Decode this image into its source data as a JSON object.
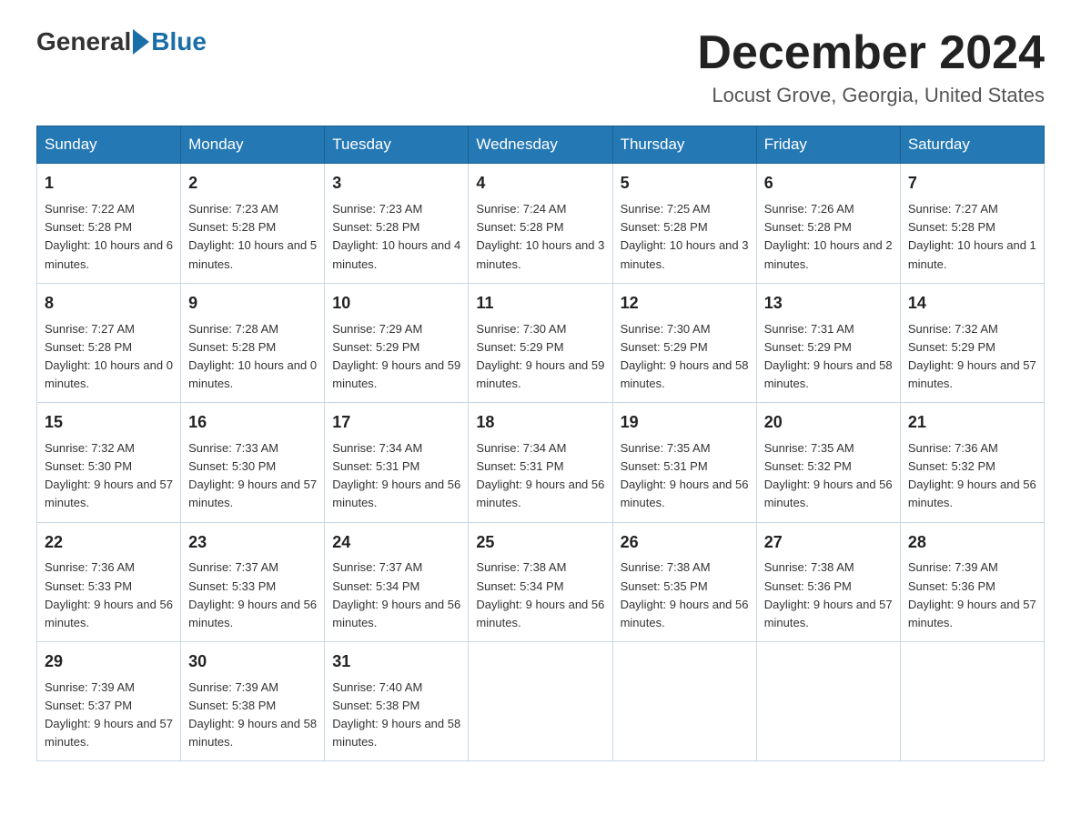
{
  "header": {
    "logo_general": "General",
    "logo_blue": "Blue",
    "month_title": "December 2024",
    "location": "Locust Grove, Georgia, United States"
  },
  "weekdays": [
    "Sunday",
    "Monday",
    "Tuesday",
    "Wednesday",
    "Thursday",
    "Friday",
    "Saturday"
  ],
  "weeks": [
    [
      {
        "day": "1",
        "sunrise": "7:22 AM",
        "sunset": "5:28 PM",
        "daylight": "10 hours and 6 minutes."
      },
      {
        "day": "2",
        "sunrise": "7:23 AM",
        "sunset": "5:28 PM",
        "daylight": "10 hours and 5 minutes."
      },
      {
        "day": "3",
        "sunrise": "7:23 AM",
        "sunset": "5:28 PM",
        "daylight": "10 hours and 4 minutes."
      },
      {
        "day": "4",
        "sunrise": "7:24 AM",
        "sunset": "5:28 PM",
        "daylight": "10 hours and 3 minutes."
      },
      {
        "day": "5",
        "sunrise": "7:25 AM",
        "sunset": "5:28 PM",
        "daylight": "10 hours and 3 minutes."
      },
      {
        "day": "6",
        "sunrise": "7:26 AM",
        "sunset": "5:28 PM",
        "daylight": "10 hours and 2 minutes."
      },
      {
        "day": "7",
        "sunrise": "7:27 AM",
        "sunset": "5:28 PM",
        "daylight": "10 hours and 1 minute."
      }
    ],
    [
      {
        "day": "8",
        "sunrise": "7:27 AM",
        "sunset": "5:28 PM",
        "daylight": "10 hours and 0 minutes."
      },
      {
        "day": "9",
        "sunrise": "7:28 AM",
        "sunset": "5:28 PM",
        "daylight": "10 hours and 0 minutes."
      },
      {
        "day": "10",
        "sunrise": "7:29 AM",
        "sunset": "5:29 PM",
        "daylight": "9 hours and 59 minutes."
      },
      {
        "day": "11",
        "sunrise": "7:30 AM",
        "sunset": "5:29 PM",
        "daylight": "9 hours and 59 minutes."
      },
      {
        "day": "12",
        "sunrise": "7:30 AM",
        "sunset": "5:29 PM",
        "daylight": "9 hours and 58 minutes."
      },
      {
        "day": "13",
        "sunrise": "7:31 AM",
        "sunset": "5:29 PM",
        "daylight": "9 hours and 58 minutes."
      },
      {
        "day": "14",
        "sunrise": "7:32 AM",
        "sunset": "5:29 PM",
        "daylight": "9 hours and 57 minutes."
      }
    ],
    [
      {
        "day": "15",
        "sunrise": "7:32 AM",
        "sunset": "5:30 PM",
        "daylight": "9 hours and 57 minutes."
      },
      {
        "day": "16",
        "sunrise": "7:33 AM",
        "sunset": "5:30 PM",
        "daylight": "9 hours and 57 minutes."
      },
      {
        "day": "17",
        "sunrise": "7:34 AM",
        "sunset": "5:31 PM",
        "daylight": "9 hours and 56 minutes."
      },
      {
        "day": "18",
        "sunrise": "7:34 AM",
        "sunset": "5:31 PM",
        "daylight": "9 hours and 56 minutes."
      },
      {
        "day": "19",
        "sunrise": "7:35 AM",
        "sunset": "5:31 PM",
        "daylight": "9 hours and 56 minutes."
      },
      {
        "day": "20",
        "sunrise": "7:35 AM",
        "sunset": "5:32 PM",
        "daylight": "9 hours and 56 minutes."
      },
      {
        "day": "21",
        "sunrise": "7:36 AM",
        "sunset": "5:32 PM",
        "daylight": "9 hours and 56 minutes."
      }
    ],
    [
      {
        "day": "22",
        "sunrise": "7:36 AM",
        "sunset": "5:33 PM",
        "daylight": "9 hours and 56 minutes."
      },
      {
        "day": "23",
        "sunrise": "7:37 AM",
        "sunset": "5:33 PM",
        "daylight": "9 hours and 56 minutes."
      },
      {
        "day": "24",
        "sunrise": "7:37 AM",
        "sunset": "5:34 PM",
        "daylight": "9 hours and 56 minutes."
      },
      {
        "day": "25",
        "sunrise": "7:38 AM",
        "sunset": "5:34 PM",
        "daylight": "9 hours and 56 minutes."
      },
      {
        "day": "26",
        "sunrise": "7:38 AM",
        "sunset": "5:35 PM",
        "daylight": "9 hours and 56 minutes."
      },
      {
        "day": "27",
        "sunrise": "7:38 AM",
        "sunset": "5:36 PM",
        "daylight": "9 hours and 57 minutes."
      },
      {
        "day": "28",
        "sunrise": "7:39 AM",
        "sunset": "5:36 PM",
        "daylight": "9 hours and 57 minutes."
      }
    ],
    [
      {
        "day": "29",
        "sunrise": "7:39 AM",
        "sunset": "5:37 PM",
        "daylight": "9 hours and 57 minutes."
      },
      {
        "day": "30",
        "sunrise": "7:39 AM",
        "sunset": "5:38 PM",
        "daylight": "9 hours and 58 minutes."
      },
      {
        "day": "31",
        "sunrise": "7:40 AM",
        "sunset": "5:38 PM",
        "daylight": "9 hours and 58 minutes."
      },
      null,
      null,
      null,
      null
    ]
  ],
  "labels": {
    "sunrise": "Sunrise:",
    "sunset": "Sunset:",
    "daylight": "Daylight:"
  }
}
